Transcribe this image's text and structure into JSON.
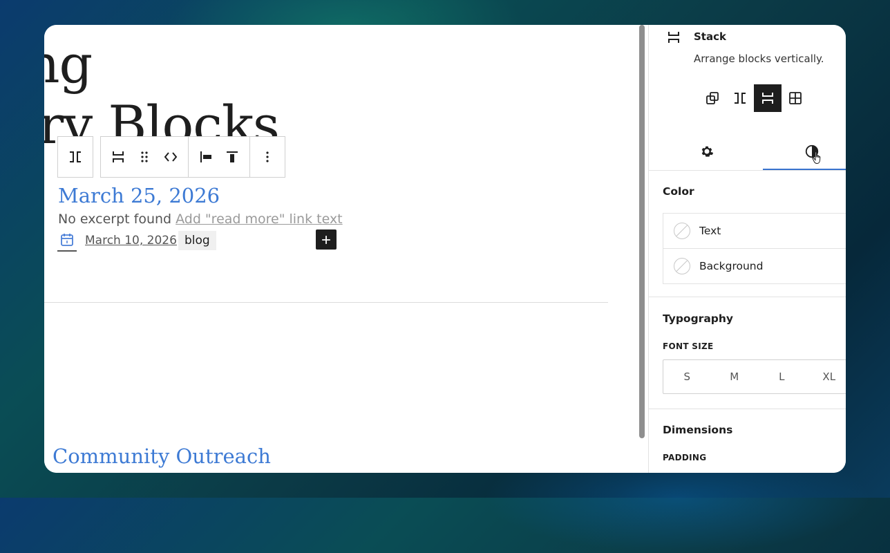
{
  "canvas": {
    "heading_line1": "nizing",
    "heading_line2": "uery Blocks",
    "post1": {
      "date_title": "March 25, 2026",
      "excerpt": "No excerpt found",
      "read_more_placeholder": "Add \"read more\" link text",
      "meta_date": "March 10, 2026",
      "tag": "blog"
    },
    "post2": {
      "title": "Community Outreach"
    }
  },
  "toolbar": {
    "icons": [
      "row-icon",
      "stack-icon",
      "drag-handle-icon",
      "move-arrows-icon",
      "justify-left-icon",
      "align-top-icon",
      "more-vertical-icon"
    ]
  },
  "sidebar": {
    "block_name": "Stack",
    "block_description": "Arrange blocks vertically.",
    "variations": [
      "group",
      "row",
      "stack",
      "grid"
    ],
    "active_variation": "stack",
    "tabs": [
      "settings",
      "styles"
    ],
    "active_tab": "styles",
    "color": {
      "title": "Color",
      "items": [
        {
          "label": "Text"
        },
        {
          "label": "Background"
        }
      ]
    },
    "typography": {
      "title": "Typography",
      "font_size_label": "FONT SIZE",
      "sizes": [
        "S",
        "M",
        "L",
        "XL"
      ]
    },
    "dimensions": {
      "title": "Dimensions",
      "padding_label": "PADDING"
    }
  },
  "colors": {
    "accent_link": "#3d7ad4",
    "tab_indicator": "#3873ce",
    "dark": "#1e1e1e"
  }
}
